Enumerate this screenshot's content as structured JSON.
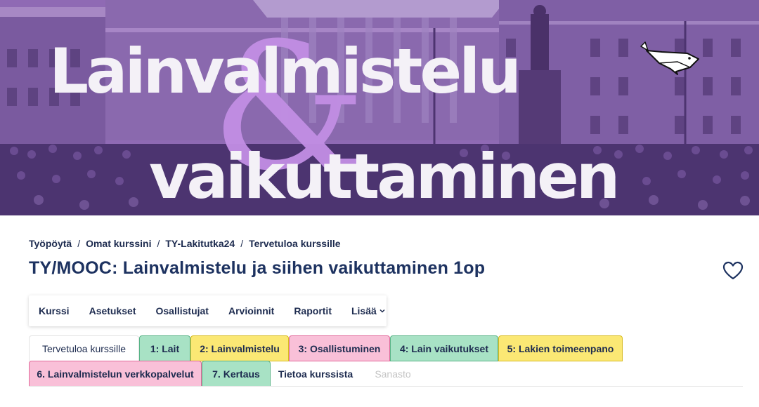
{
  "banner": {
    "title_line1": "Lainvalmistelu",
    "ampersand": "&",
    "title_line2": "vaikuttaminen",
    "overlay_color": "#7d57a5",
    "accent_color": "#c28ee4"
  },
  "breadcrumb": [
    {
      "label": "Työpöytä"
    },
    {
      "label": "Omat kurssini"
    },
    {
      "label": "TY-Lakitutka24"
    },
    {
      "label": "Tervetuloa kurssille"
    }
  ],
  "breadcrumb_separator": "/",
  "page_title": "TY/MOOC: Lainvalmistelu ja siihen vaikuttaminen 1op",
  "favourite_icon": "heart-icon",
  "secondary_nav": {
    "items": [
      "Kurssi",
      "Asetukset",
      "Osallistujat",
      "Arvioinnit",
      "Raportit"
    ],
    "more_label": "Lisää"
  },
  "section_tabs": [
    {
      "label": "Tervetuloa kurssille",
      "color": "plain",
      "active": true
    },
    {
      "label": "1: Lait",
      "color": "green"
    },
    {
      "label": "2: Lainvalmistelu",
      "color": "yellow"
    },
    {
      "label": "3: Osallistuminen",
      "color": "pink"
    },
    {
      "label": "4: Lain vaikutukset",
      "color": "green"
    },
    {
      "label": "5: Lakien toimeenpano",
      "color": "yellow"
    },
    {
      "label": "6. Lainvalmistelun verkkopalvelut",
      "color": "pink"
    },
    {
      "label": "7. Kertaus",
      "color": "green"
    },
    {
      "label": "Tietoa kurssista",
      "color": "none"
    },
    {
      "label": "Sanasto",
      "color": "muted"
    }
  ],
  "tab_colors": {
    "green": "#a8e2c5",
    "yellow": "#fbe874",
    "pink": "#f9c0d8"
  }
}
